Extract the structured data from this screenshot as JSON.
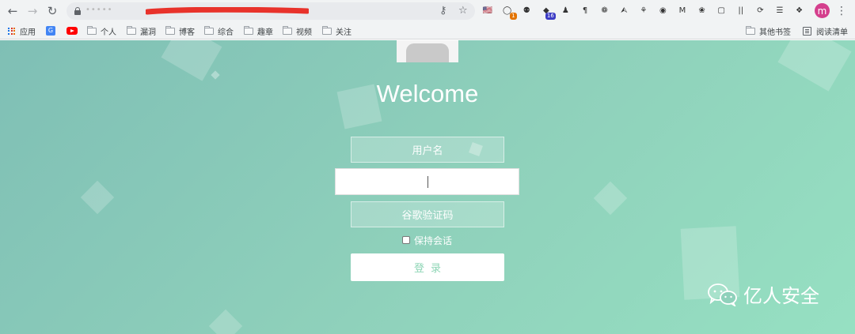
{
  "browser": {
    "url_text": "•••••",
    "extensions": [
      {
        "name": "flag-extension",
        "glyph": "🇺🇸"
      },
      {
        "name": "circle-badge-extension",
        "glyph": "◯",
        "badge": "1",
        "badge_color": "#e37400"
      },
      {
        "name": "pin-extension",
        "glyph": "⚉"
      },
      {
        "name": "graduation-cap-extension",
        "glyph": "◆",
        "badge": "16",
        "badge_color": "#3b3bc4"
      },
      {
        "name": "spy-extension",
        "glyph": "♟"
      },
      {
        "name": "paragraph-extension",
        "glyph": "¶"
      },
      {
        "name": "bike-extension",
        "glyph": "❁"
      },
      {
        "name": "arrow-circle-extension",
        "glyph": "⮙"
      },
      {
        "name": "puzzle-people-extension",
        "glyph": "⚘"
      },
      {
        "name": "cookie-extension",
        "glyph": "◉"
      },
      {
        "name": "m-square-extension",
        "glyph": "M"
      },
      {
        "name": "globe-extension",
        "glyph": "❀"
      },
      {
        "name": "window-extension",
        "glyph": "▢"
      },
      {
        "name": "bars-extension",
        "glyph": "||"
      },
      {
        "name": "green-circle-extension",
        "glyph": "⟳"
      },
      {
        "name": "hat-extension",
        "glyph": "☰"
      },
      {
        "name": "puzzle-icon",
        "glyph": "❖"
      }
    ],
    "avatar_letter": "m",
    "bookmarks": [
      {
        "label": "应用",
        "icon": "apps-grid-icon"
      },
      {
        "label": "",
        "icon": "translate-icon"
      },
      {
        "label": "",
        "icon": "youtube-icon"
      },
      {
        "label": "个人",
        "icon": "folder-icon"
      },
      {
        "label": "漏洞",
        "icon": "folder-icon"
      },
      {
        "label": "博客",
        "icon": "folder-icon"
      },
      {
        "label": "综合",
        "icon": "folder-icon"
      },
      {
        "label": "趣章",
        "icon": "folder-icon"
      },
      {
        "label": "视频",
        "icon": "folder-icon"
      },
      {
        "label": "关注",
        "icon": "folder-icon"
      }
    ],
    "other_bookmarks": "其他书签",
    "reading_list": "阅读清单"
  },
  "login": {
    "title": "Welcome",
    "username_placeholder": "用户名",
    "password_value": "",
    "captcha_label": "谷歌验证码",
    "remember_label": "保持会话",
    "remember_checked": false,
    "submit_label": "登录"
  },
  "watermark": {
    "text": "亿人安全"
  },
  "colors": {
    "page_gradient_start": "#7fbfb5",
    "page_gradient_end": "#96e0c2",
    "login_button_text": "#8dd5b5",
    "redaction": "#e8322b"
  }
}
